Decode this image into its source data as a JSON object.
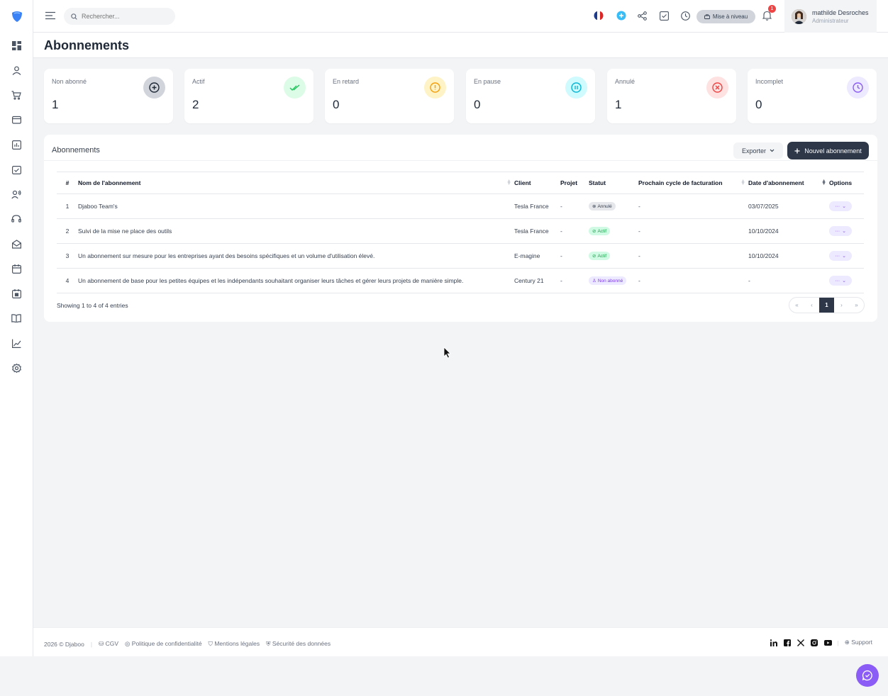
{
  "search": {
    "placeholder": "Rechercher..."
  },
  "topbar": {
    "upgrade_label": "Mise à niveau",
    "notif_count": "1"
  },
  "user": {
    "name": "mathilde Desroches",
    "role": "Administrateur"
  },
  "page": {
    "title": "Abonnements"
  },
  "stats": [
    {
      "label": "Non abonné",
      "value": "1",
      "color": "#374151",
      "bg": "#e5e7eb",
      "icon": "plus-circle-icon"
    },
    {
      "label": "Actif",
      "value": "2",
      "color": "#22c55e",
      "bg": "#dcfce7",
      "icon": "double-check-icon"
    },
    {
      "label": "En retard",
      "value": "0",
      "color": "#f59e0b",
      "bg": "#fef3c7",
      "icon": "alert-circle-icon"
    },
    {
      "label": "En pause",
      "value": "0",
      "color": "#06b6d4",
      "bg": "#cffafe",
      "icon": "pause-circle-icon"
    },
    {
      "label": "Annulé",
      "value": "1",
      "color": "#ef4444",
      "bg": "#fee2e2",
      "icon": "x-circle-icon"
    },
    {
      "label": "Incomplet",
      "value": "0",
      "color": "#8b5cf6",
      "bg": "#ede9fe",
      "icon": "clock-icon"
    }
  ],
  "panel": {
    "title": "Abonnements",
    "export_label": "Exporter",
    "new_label": "Nouvel abonnement"
  },
  "table": {
    "headers": {
      "num": "#",
      "name": "Nom de l'abonnement",
      "client": "Client",
      "project": "Projet",
      "status": "Statut",
      "next_cycle": "Prochain cycle de facturation",
      "date": "Date d'abonnement",
      "options": "Options"
    },
    "rows": [
      {
        "num": "1",
        "name": "Djaboo Team's",
        "client": "Tesla France",
        "project": "-",
        "status": "Annulé",
        "next_cycle": "-",
        "date": "03/07/2025"
      },
      {
        "num": "2",
        "name": "Suivi de la mise ne place des outils",
        "client": "Tesla France",
        "project": "-",
        "status": "Actif",
        "next_cycle": "-",
        "date": "10/10/2024"
      },
      {
        "num": "3",
        "name": "Un abonnement sur mesure pour les entreprises ayant des besoins spécifiques et un volume d'utilisation élevé.",
        "client": "E-magine",
        "project": "-",
        "status": "Actif",
        "next_cycle": "-",
        "date": "10/10/2024"
      },
      {
        "num": "4",
        "name": "Un abonnement de base pour les petites équipes et les indépendants souhaitant organiser leurs tâches et gérer leurs projets de manière simple.",
        "client": "Century 21",
        "project": "-",
        "status": "Non abonné",
        "next_cycle": "-",
        "date": "-"
      }
    ],
    "option_label": "···"
  },
  "pagination": {
    "summary": "Showing 1 to 4 of 4 entries",
    "first": "«",
    "prev": "‹",
    "current": "1",
    "next": "›",
    "last": "»"
  },
  "footer": {
    "copyright": "2026 © Djaboo",
    "cgv": "CGV",
    "privacy": "Politique de confidentialité",
    "legal": "Mentions légales",
    "security": "Sécurité des données",
    "support": "Support"
  }
}
